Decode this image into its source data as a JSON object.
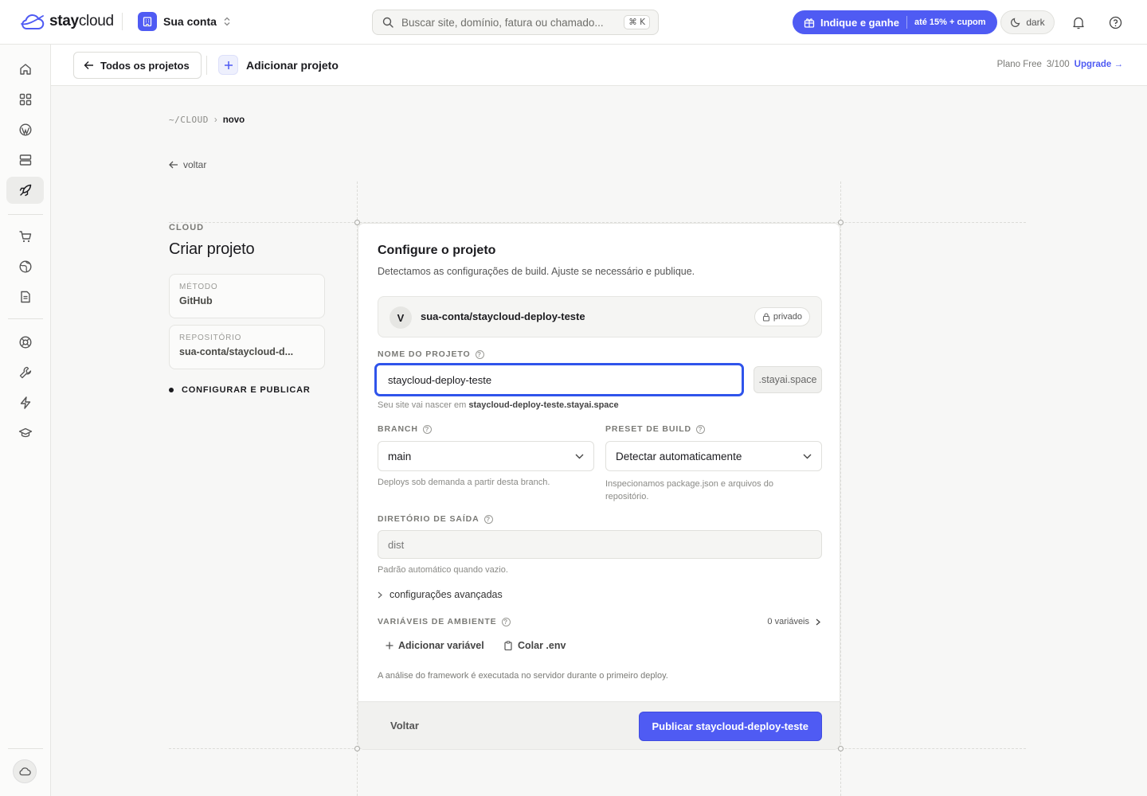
{
  "brand": {
    "name_bold": "stay",
    "name_light": "cloud"
  },
  "account": {
    "name": "Sua conta"
  },
  "search": {
    "placeholder": "Buscar site, domínio, fatura ou chamado...",
    "shortcut": "⌘ K"
  },
  "referral": {
    "label": "Indique e ganhe",
    "promo": "até 15% + cupom"
  },
  "theme": {
    "label": "dark"
  },
  "sidebar": {
    "items": [
      {
        "icon": "home-icon",
        "active": false
      },
      {
        "icon": "dashboard-icon",
        "active": false
      },
      {
        "icon": "wordpress-icon",
        "active": false
      },
      {
        "icon": "server-icon",
        "active": false
      },
      {
        "icon": "rocket-icon",
        "active": true
      },
      {
        "icon": "cart-icon",
        "active": false
      },
      {
        "icon": "globe-icon",
        "active": false
      },
      {
        "icon": "document-icon",
        "active": false
      },
      {
        "icon": "lifebuoy-icon",
        "active": false
      },
      {
        "icon": "wrench-icon",
        "active": false
      },
      {
        "icon": "lightning-icon",
        "active": false
      },
      {
        "icon": "graduation-cap-icon",
        "active": false
      }
    ]
  },
  "subheader": {
    "back_label": "Todos os projetos",
    "add_label": "Adicionar projeto",
    "plan_label": "Plano Free",
    "plan_usage": "3/100",
    "upgrade_label": "Upgrade →"
  },
  "breadcrumb": {
    "parent": "~/CLOUD",
    "separator": "›",
    "current": "novo"
  },
  "back_link": "voltar",
  "left": {
    "eyebrow": "CLOUD",
    "title": "Criar projeto",
    "method_label": "MÉTODO",
    "method_value": "GitHub",
    "repo_label": "REPOSITÓRIO",
    "repo_value": "sua-conta/staycloud-d...",
    "active_step": "CONFIGURAR E PUBLICAR"
  },
  "card": {
    "title": "Configure o projeto",
    "description": "Detectamos as configurações de build. Ajuste se necessário e publique.",
    "repo": {
      "avatar_letter": "V",
      "name": "sua-conta/staycloud-deploy-teste",
      "visibility": "privado"
    },
    "project_name": {
      "label": "NOME DO PROJETO",
      "value": "staycloud-deploy-teste",
      "suffix": ".stayai.space",
      "hint_prefix": "Seu site vai nascer em ",
      "hint_domain": "staycloud-deploy-teste.stayai.space"
    },
    "branch": {
      "label": "BRANCH",
      "value": "main",
      "hint": "Deploys sob demanda a partir desta branch."
    },
    "preset": {
      "label": "PRESET DE BUILD",
      "value": "Detectar automaticamente",
      "hint_line1": "Inspecionamos package.json e arquivos do",
      "hint_line2": "repositório."
    },
    "output": {
      "label": "DIRETÓRIO DE SAÍDA",
      "placeholder": "dist",
      "hint": "Padrão automático quando vazio."
    },
    "advanced_label": "configurações avançadas",
    "env": {
      "label": "VARIÁVEIS DE AMBIENTE",
      "count": "0 variáveis",
      "add_label": "Adicionar variável",
      "paste_label": "Colar .env"
    },
    "footnote": "A análise do framework é executada no servidor durante o primeiro deploy.",
    "footer": {
      "back_label": "Voltar",
      "publish_label": "Publicar staycloud-deploy-teste"
    }
  },
  "colors": {
    "accent": "#4f5bf3",
    "focus_ring": "#2f54eb",
    "background": "#f7f7f6"
  }
}
